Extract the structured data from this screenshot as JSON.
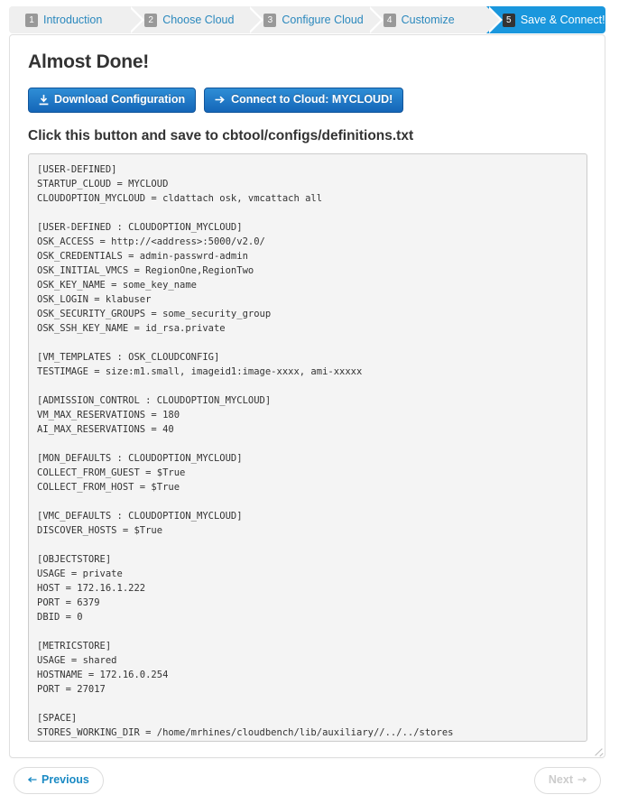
{
  "wizard": {
    "steps": [
      {
        "number": "1",
        "label": "Introduction",
        "active": false
      },
      {
        "number": "2",
        "label": "Choose Cloud",
        "active": false
      },
      {
        "number": "3",
        "label": "Configure Cloud",
        "active": false
      },
      {
        "number": "4",
        "label": "Customize",
        "active": false
      },
      {
        "number": "5",
        "label": "Save & Connect!",
        "active": true
      }
    ],
    "active_color": "#1a97dd",
    "inactive_bg": "#efefef",
    "link_color": "#2a88bd"
  },
  "main": {
    "title": "Almost Done!",
    "subtitle": "Click this button and save to cbtool/configs/definitions.txt",
    "buttons": {
      "download_label": "Download Configuration",
      "download_icon": "download-icon",
      "connect_label": "Connect to Cloud: MYCLOUD!",
      "connect_icon": "arrow-right-icon",
      "primary_color": "#1566b8"
    },
    "config_text": "[USER-DEFINED]\nSTARTUP_CLOUD = MYCLOUD\nCLOUDOPTION_MYCLOUD = cldattach osk, vmcattach all\n\n[USER-DEFINED : CLOUDOPTION_MYCLOUD]\nOSK_ACCESS = http://<address>:5000/v2.0/\nOSK_CREDENTIALS = admin-passwrd-admin\nOSK_INITIAL_VMCS = RegionOne,RegionTwo\nOSK_KEY_NAME = some_key_name\nOSK_LOGIN = klabuser\nOSK_SECURITY_GROUPS = some_security_group\nOSK_SSH_KEY_NAME = id_rsa.private\n\n[VM_TEMPLATES : OSK_CLOUDCONFIG]\nTESTIMAGE = size:m1.small, imageid1:image-xxxx, ami-xxxxx\n\n[ADMISSION_CONTROL : CLOUDOPTION_MYCLOUD]\nVM_MAX_RESERVATIONS = 180\nAI_MAX_RESERVATIONS = 40\n\n[MON_DEFAULTS : CLOUDOPTION_MYCLOUD]\nCOLLECT_FROM_GUEST = $True\nCOLLECT_FROM_HOST = $True\n\n[VMC_DEFAULTS : CLOUDOPTION_MYCLOUD]\nDISCOVER_HOSTS = $True\n\n[OBJECTSTORE]\nUSAGE = private\nHOST = 172.16.1.222\nPORT = 6379\nDBID = 0\n\n[METRICSTORE]\nUSAGE = shared\nHOSTNAME = 172.16.0.254\nPORT = 27017\n\n[SPACE]\nSTORES_WORKING_DIR = /home/mrhines/cloudbench/lib/auxiliary//../../stores"
  },
  "footer": {
    "previous_label": "Previous",
    "previous_icon": "arrow-left-icon",
    "next_label": "Next",
    "next_icon": "arrow-right-icon",
    "previous_color": "#1a8ac4",
    "next_color": "#cccccc"
  }
}
